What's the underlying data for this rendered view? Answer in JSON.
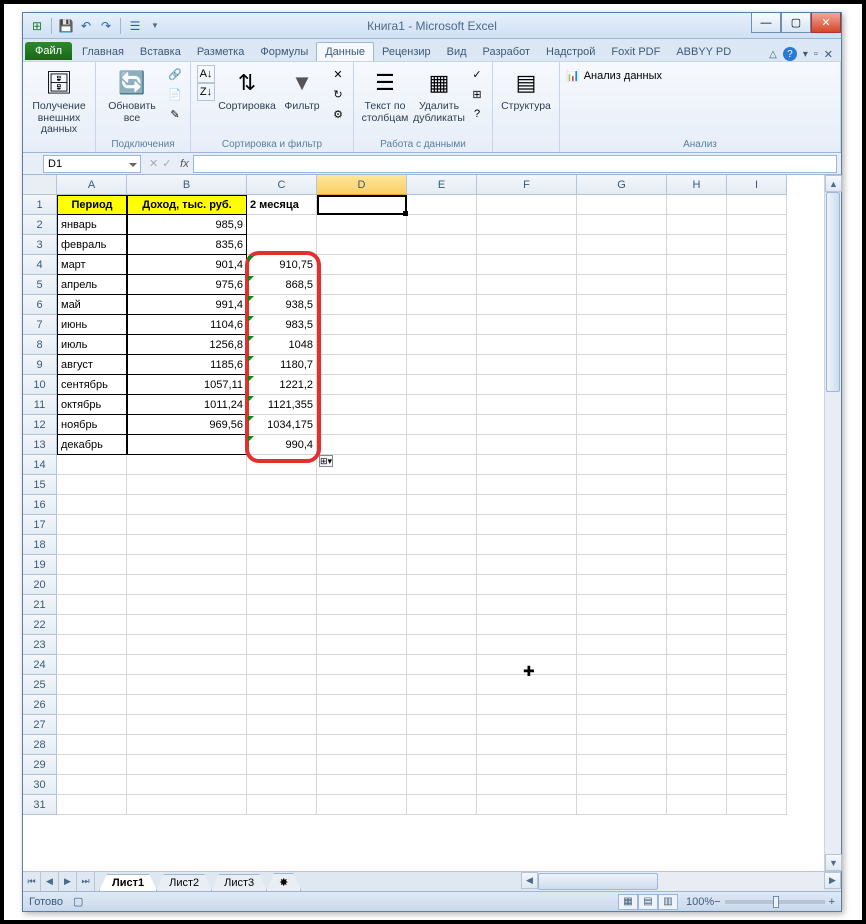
{
  "title": "Книга1 - Microsoft Excel",
  "qat_icons": [
    "excel",
    "save",
    "undo",
    "redo",
    "print-preview",
    "list"
  ],
  "ribbon": {
    "file": "Файл",
    "tabs": [
      "Главная",
      "Вставка",
      "Разметка",
      "Формулы",
      "Данные",
      "Рецензир",
      "Вид",
      "Разработ",
      "Надстрой",
      "Foxit PDF",
      "ABBYY PD"
    ],
    "active": "Данные",
    "groups": {
      "external": {
        "btn": "Получение внешних данных",
        "label": ""
      },
      "connections": {
        "btn": "Обновить все",
        "label": "Подключения"
      },
      "sort": {
        "sortbtn": "Сортировка",
        "filterbtn": "Фильтр",
        "label": "Сортировка и фильтр"
      },
      "tools": {
        "t2c": "Текст по столбцам",
        "dedup": "Удалить дубликаты",
        "label": "Работа с данными"
      },
      "outline": {
        "btn": "Структура",
        "label": ""
      },
      "analysis": {
        "btn": "Анализ данных",
        "label": "Анализ"
      }
    }
  },
  "namebox": "D1",
  "formula": "",
  "columns": [
    "A",
    "B",
    "C",
    "D",
    "E",
    "F",
    "G",
    "H",
    "I"
  ],
  "header_row": {
    "A": "Период",
    "B": "Доход, тыс. руб.",
    "C": "2 месяца"
  },
  "rows": [
    {
      "n": 2,
      "A": "январь",
      "B": "985,9",
      "C": ""
    },
    {
      "n": 3,
      "A": "февраль",
      "B": "835,6",
      "C": ""
    },
    {
      "n": 4,
      "A": "март",
      "B": "901,4",
      "C": "910,75"
    },
    {
      "n": 5,
      "A": "апрель",
      "B": "975,6",
      "C": "868,5"
    },
    {
      "n": 6,
      "A": "май",
      "B": "991,4",
      "C": "938,5"
    },
    {
      "n": 7,
      "A": "июнь",
      "B": "1104,6",
      "C": "983,5"
    },
    {
      "n": 8,
      "A": "июль",
      "B": "1256,8",
      "C": "1048"
    },
    {
      "n": 9,
      "A": "август",
      "B": "1185,6",
      "C": "1180,7"
    },
    {
      "n": 10,
      "A": "сентябрь",
      "B": "1057,11",
      "C": "1221,2"
    },
    {
      "n": 11,
      "A": "октябрь",
      "B": "1011,24",
      "C": "1121,355"
    },
    {
      "n": 12,
      "A": "ноябрь",
      "B": "969,56",
      "C": "1034,175"
    },
    {
      "n": 13,
      "A": "декабрь",
      "B": "",
      "C": "990,4"
    }
  ],
  "empty_rows_from": 14,
  "empty_rows_to": 31,
  "sheets": [
    "Лист1",
    "Лист2",
    "Лист3"
  ],
  "active_sheet": "Лист1",
  "status": "Готово",
  "zoom": "100%"
}
